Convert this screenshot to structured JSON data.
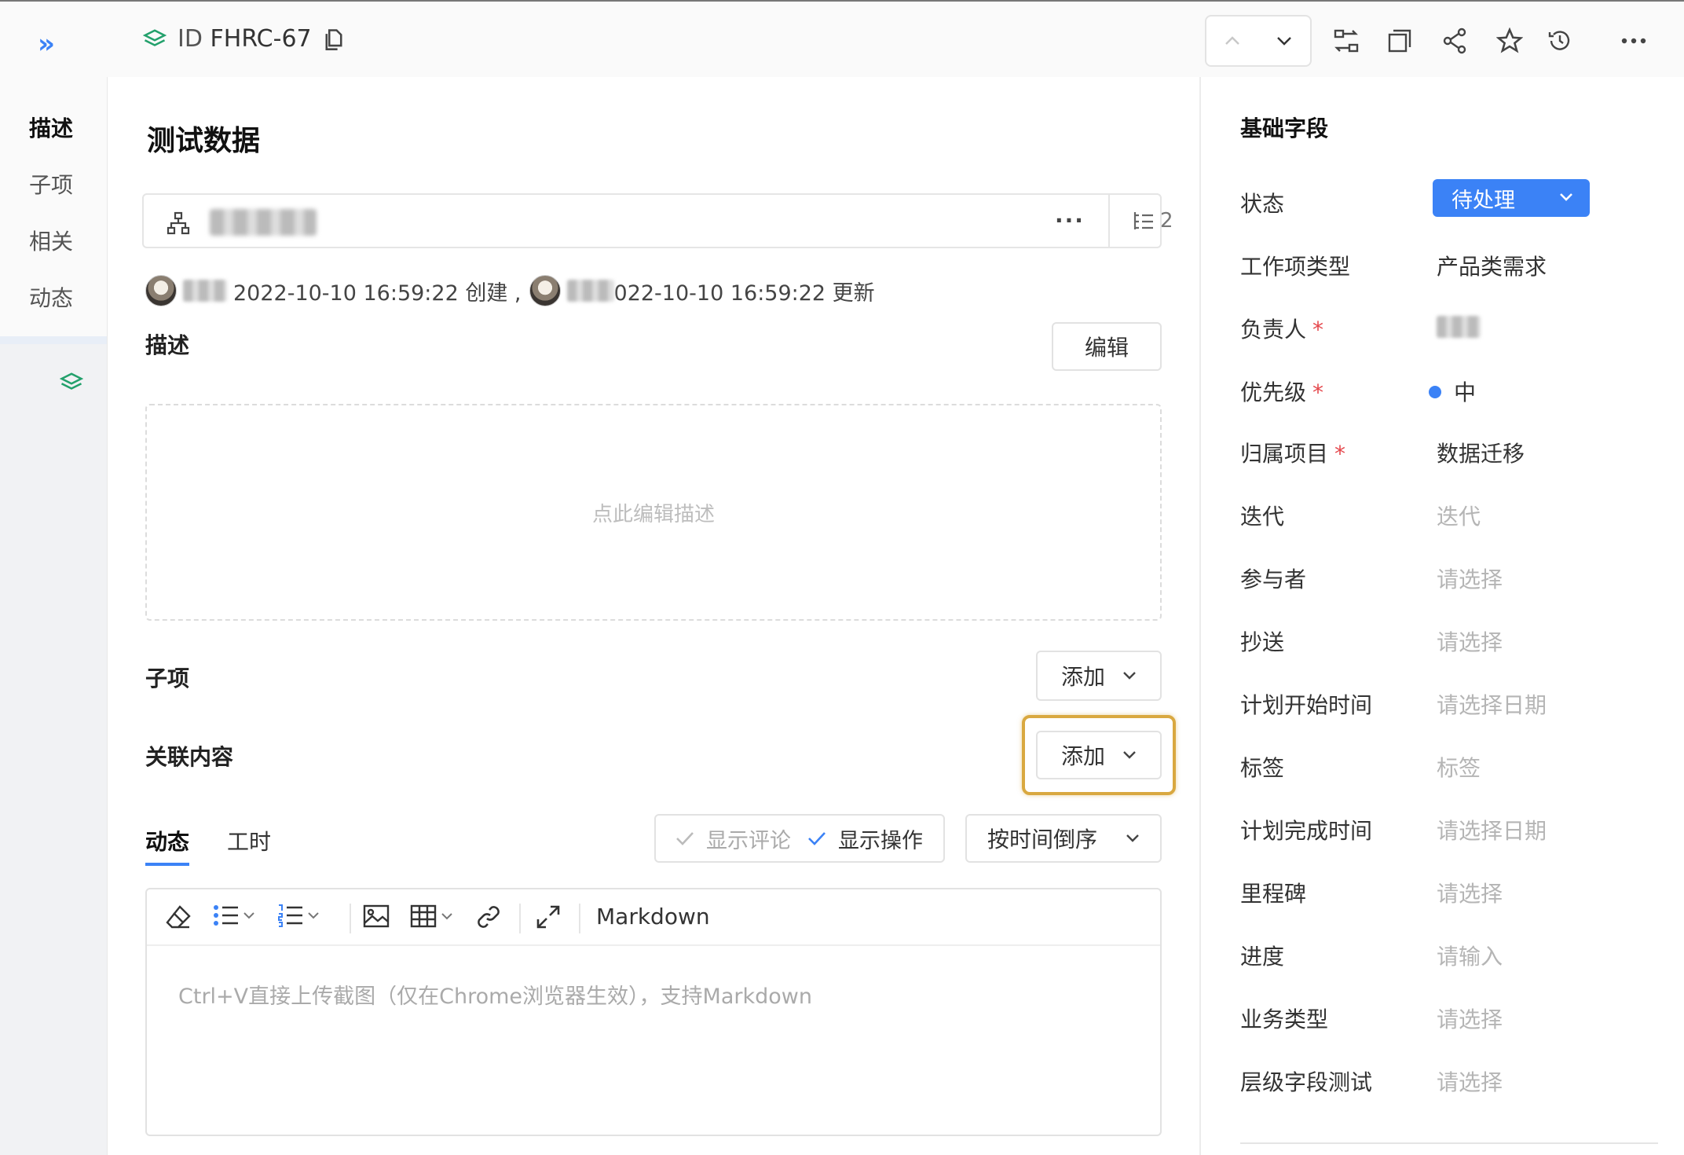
{
  "topbar": {
    "id_prefix": "ID",
    "id_value": "FHRC-67"
  },
  "leftnav": {
    "items": [
      {
        "label": "描述",
        "active": true
      },
      {
        "label": "子项",
        "active": false
      },
      {
        "label": "相关",
        "active": false
      },
      {
        "label": "动态",
        "active": false
      }
    ]
  },
  "main": {
    "title": "测试数据",
    "parent": {
      "children_count": "2"
    },
    "meta": {
      "created_text": "2022-10-10 16:59:22 创建 ,",
      "updated_text": "022-10-10 16:59:22 更新"
    },
    "description": {
      "label": "描述",
      "edit_label": "编辑",
      "placeholder": "点此编辑描述"
    },
    "children": {
      "label": "子项",
      "add_label": "添加"
    },
    "related": {
      "label": "关联内容",
      "add_label": "添加"
    },
    "tabs": [
      {
        "label": "动态",
        "active": true
      },
      {
        "label": "工时",
        "active": false
      }
    ],
    "filters": {
      "show_comments": "显示评论",
      "show_actions": "显示操作",
      "sort_label": "按时间倒序"
    },
    "editor": {
      "mode_label": "Markdown",
      "placeholder": "Ctrl+V直接上传截图（仅在Chrome浏览器生效），支持Markdown"
    }
  },
  "right": {
    "title": "基础字段",
    "fields": [
      {
        "label": "状态",
        "value": "待处理",
        "kind": "status"
      },
      {
        "label": "工作项类型",
        "value": "产品类需求",
        "kind": "value"
      },
      {
        "label": "负责人",
        "required": true,
        "value": "",
        "kind": "user"
      },
      {
        "label": "优先级",
        "required": true,
        "value": "中",
        "kind": "priority"
      },
      {
        "label": "归属项目",
        "required": true,
        "value": "数据迁移",
        "kind": "value"
      },
      {
        "label": "迭代",
        "value": "迭代",
        "kind": "placeholder"
      },
      {
        "label": "参与者",
        "value": "请选择",
        "kind": "placeholder"
      },
      {
        "label": "抄送",
        "value": "请选择",
        "kind": "placeholder"
      },
      {
        "label": "计划开始时间",
        "value": "请选择日期",
        "kind": "placeholder"
      },
      {
        "label": "标签",
        "value": "标签",
        "kind": "placeholder"
      },
      {
        "label": "计划完成时间",
        "value": "请选择日期",
        "kind": "placeholder"
      },
      {
        "label": "里程碑",
        "value": "请选择",
        "kind": "placeholder"
      },
      {
        "label": "进度",
        "value": "请输入",
        "kind": "placeholder"
      },
      {
        "label": "业务类型",
        "value": "请选择",
        "kind": "placeholder"
      },
      {
        "label": "层级字段测试",
        "value": "请选择",
        "kind": "placeholder"
      }
    ],
    "required_mark": "*"
  },
  "colors": {
    "accent": "#3b82f6",
    "brand_green": "#22a06b",
    "required": "#e5484d",
    "highlight": "#d9a840"
  },
  "icons": [
    "expand-icon",
    "layers-icon",
    "copy-icon",
    "chevron-up-icon",
    "chevron-down-icon",
    "transfer-icon",
    "window-icon",
    "share-icon",
    "star-icon",
    "history-icon",
    "more-icon",
    "hierarchy-icon",
    "subtasks-icon",
    "check-icon",
    "eraser-icon",
    "bullet-list-icon",
    "ordered-list-icon",
    "image-icon",
    "table-icon",
    "link-icon",
    "fullscreen-icon"
  ]
}
